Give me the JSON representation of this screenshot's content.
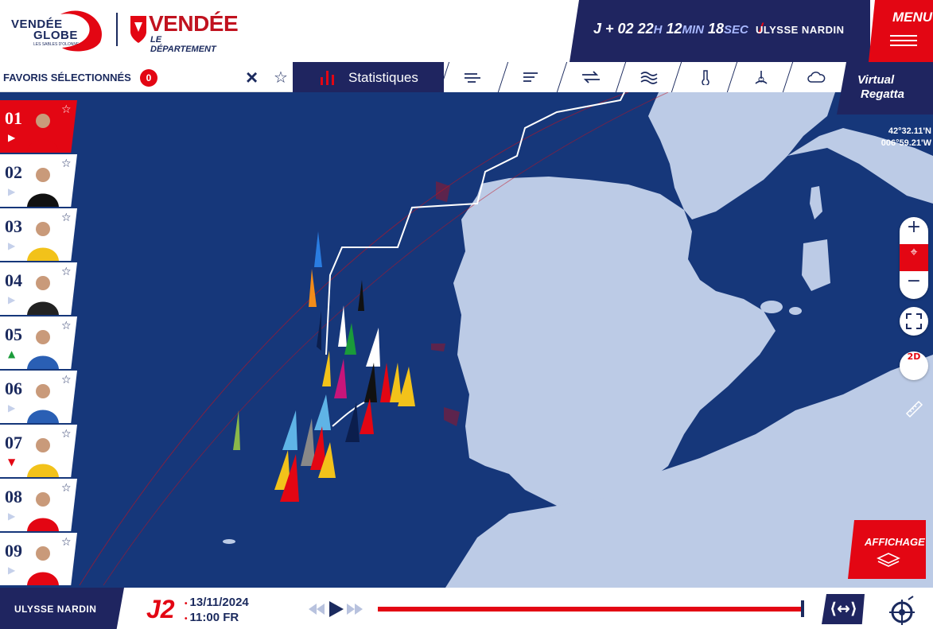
{
  "header": {
    "logo_vendee_globe_line1": "VENDÉE",
    "logo_vendee_globe_line2": "GLOBE",
    "logo_vendee_globe_sub": "LES SABLES D'OLONNE",
    "logo_department_title": "VENDÉE",
    "logo_department_sub": "LE DÉPARTEMENT",
    "timer": {
      "days": "J + 02",
      "hours": "22",
      "hours_unit": "H",
      "minutes": "12",
      "minutes_unit": "MIN",
      "seconds": "18",
      "seconds_unit": "SEC"
    },
    "sponsor": "ULYSSE NARDIN",
    "menu_label": "MENU"
  },
  "toolbar": {
    "favorites_label": "FAVORIS SÉLECTIONNÉS",
    "favorites_count": "0",
    "clear_icon": "close-icon",
    "star_icon": "star-outline-icon",
    "stats_label": "Statistiques",
    "layers": [
      "wind-icon",
      "gust-icon",
      "current-icon",
      "waves-icon",
      "temperature-icon",
      "pressure-icon",
      "cloud-icon"
    ],
    "virtual_regatta_line1": "Virtual",
    "virtual_regatta_line2": "Regatta"
  },
  "skippers": [
    {
      "rank": "01",
      "trend": "▶",
      "trend_color": "#ffffff",
      "active": true
    },
    {
      "rank": "02",
      "trend": "▶",
      "trend_color": "#c5d0ea",
      "active": false
    },
    {
      "rank": "03",
      "trend": "▶",
      "trend_color": "#c5d0ea",
      "active": false
    },
    {
      "rank": "04",
      "trend": "▶",
      "trend_color": "#c5d0ea",
      "active": false
    },
    {
      "rank": "05",
      "trend": "▲",
      "trend_color": "#1a9b3a",
      "active": false
    },
    {
      "rank": "06",
      "trend": "▶",
      "trend_color": "#c5d0ea",
      "active": false
    },
    {
      "rank": "07",
      "trend": "▼",
      "trend_color": "#e30613",
      "active": false
    },
    {
      "rank": "08",
      "trend": "▶",
      "trend_color": "#c5d0ea",
      "active": false
    },
    {
      "rank": "09",
      "trend": "▶",
      "trend_color": "#c5d0ea",
      "active": false
    }
  ],
  "map": {
    "latitude": "42°32.11'N",
    "longitude": "006°59.21'W",
    "sea_color": "#16377a",
    "land_color": "#bccbe6"
  },
  "controls": {
    "zoom_in": "+",
    "locate": "⌖",
    "zoom_out": "−",
    "fullscreen": "fullscreen-icon",
    "view_mode": "2D",
    "ruler": "ruler-icon",
    "display_label": "AFFICHAGE"
  },
  "bottom": {
    "sponsor": "ULYSSE NARDIN",
    "day": "J2",
    "date": "13/11/2024",
    "time": "11:00 FR",
    "expand_icon": "expand-horizontal-icon",
    "timeline_progress": 1.0
  }
}
